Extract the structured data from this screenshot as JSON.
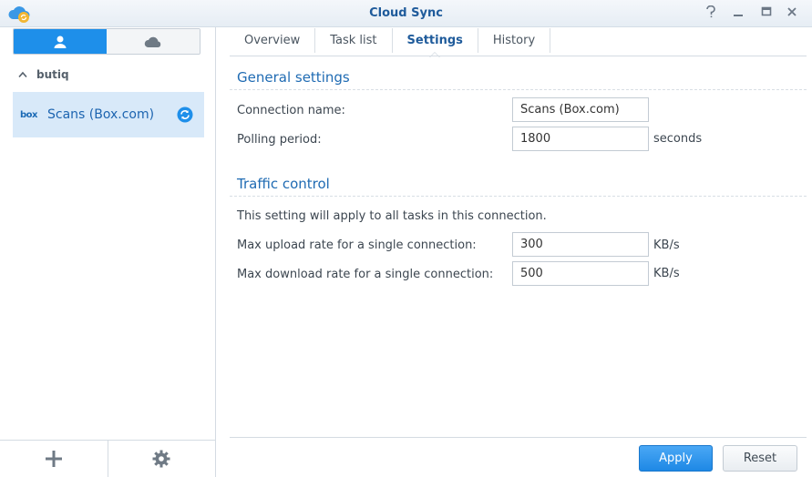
{
  "window": {
    "title": "Cloud Sync",
    "help_icon": "help-icon",
    "minimize_icon": "minimize-icon",
    "maximize_icon": "maximize-icon",
    "close_icon": "close-icon"
  },
  "sidebar": {
    "segments": [
      {
        "icon": "user-icon",
        "active": true
      },
      {
        "icon": "cloud-icon",
        "active": false
      }
    ],
    "group": {
      "label": "butiq",
      "expanded": true
    },
    "connections": [
      {
        "provider_logo": "box",
        "label": "Scans (Box.com)",
        "status_icon": "sync-icon",
        "selected": true
      }
    ],
    "footer": {
      "add_icon": "plus-icon",
      "settings_icon": "gear-icon"
    }
  },
  "tabs": [
    {
      "label": "Overview",
      "active": false
    },
    {
      "label": "Task list",
      "active": false
    },
    {
      "label": "Settings",
      "active": true
    },
    {
      "label": "History",
      "active": false
    }
  ],
  "general": {
    "title": "General settings",
    "connection_name_label": "Connection name:",
    "connection_name_value": "Scans (Box.com)",
    "polling_label": "Polling period:",
    "polling_value": "1800",
    "polling_unit": "seconds"
  },
  "traffic": {
    "title": "Traffic control",
    "note": "This setting will apply to all tasks in this connection.",
    "upload_label": "Max upload rate for a single connection:",
    "upload_value": "300",
    "upload_unit": "KB/s",
    "download_label": "Max download rate for a single connection:",
    "download_value": "500",
    "download_unit": "KB/s"
  },
  "actions": {
    "apply_label": "Apply",
    "reset_label": "Reset"
  },
  "colors": {
    "accent": "#1e8fea",
    "title_text": "#1f5b9b",
    "selected_bg": "#d8e9f9"
  }
}
